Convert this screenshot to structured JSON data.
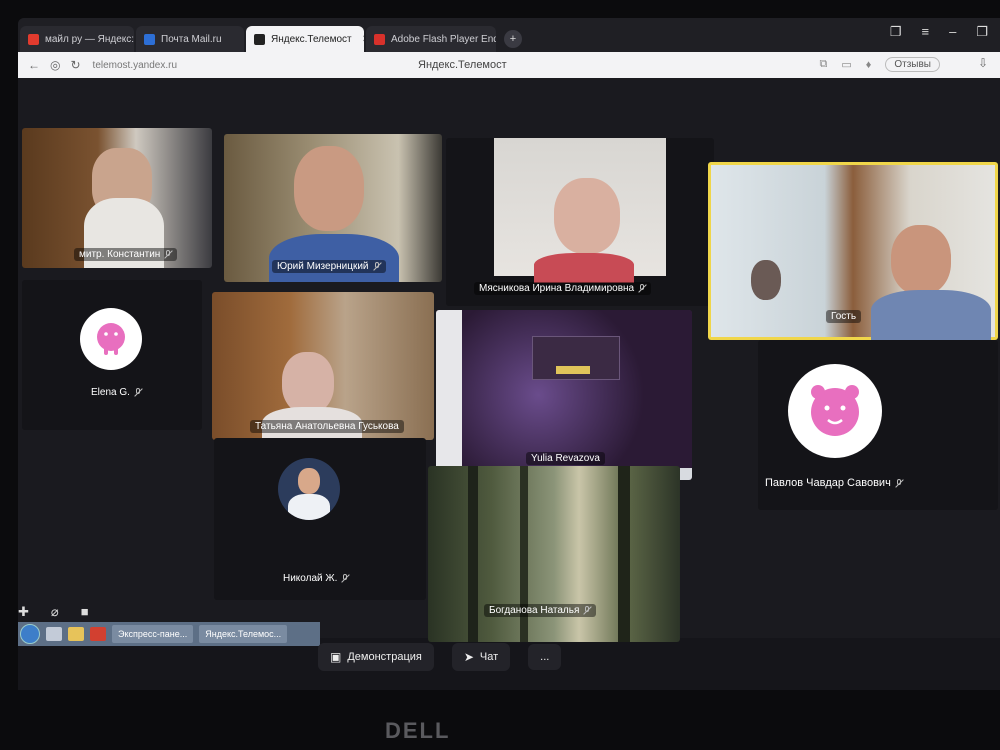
{
  "browser": {
    "tabs": [
      {
        "label": "майл ру — Яндекс: нашл",
        "color": "#e23b2e",
        "active": false
      },
      {
        "label": "Почта Mail.ru",
        "color": "#2d6fd6",
        "active": false
      },
      {
        "label": "Яндекс.Телемост",
        "color": "#222222",
        "active": true
      },
      {
        "label": "Adobe Flash Player End of",
        "color": "#d8312b",
        "active": false
      }
    ],
    "url": "telemost.yandex.ru",
    "page_title": "Яндекс.Телемост",
    "feedback_label": "Отзывы"
  },
  "participants": {
    "p1": "митр. Константин",
    "p2": "Юрий Мизерницкий",
    "p3": "Мясникова Ирина Владимировна",
    "p4": "Гость",
    "p5": "Elena G.",
    "p6": "Татьяна Анатольевна Гуськова",
    "p7": "Yulia Revazova",
    "p8": "Павлов Чавдар Савович",
    "p9": "Николай Ж.",
    "p10": "Богданова Наталья"
  },
  "toolbar": {
    "screen_share_label": "Демонстрация",
    "chat_label": "Чат",
    "more_label": "..."
  },
  "taskbar": {
    "apps": [
      "Экспресс-пане...",
      "Яндекс.Телемос..."
    ]
  },
  "monitor_brand": "DELL",
  "colors": {
    "speaking_border": "#f0d64a",
    "avatar_pink": "#e86fbf"
  }
}
